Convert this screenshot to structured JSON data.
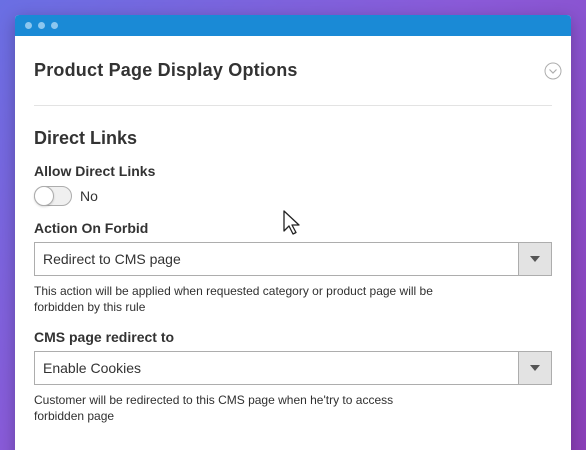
{
  "section": {
    "title": "Product Page Display Options"
  },
  "direct_links": {
    "group_title": "Direct Links",
    "allow_label": "Allow Direct Links",
    "allow_value": "No",
    "action_label": "Action On Forbid",
    "action_value": "Redirect to CMS page",
    "action_note": "This action will be applied when requested category or product page will be forbidden by this rule",
    "cms_label": "CMS page redirect to",
    "cms_value": "Enable Cookies",
    "cms_note": "Customer will be redirected to this CMS page when he'try to access forbidden page"
  },
  "colors": {
    "titlebar": "#1a8ad6",
    "background_start": "#6a6fe3",
    "background_end": "#8b3fb8"
  },
  "icons": {
    "collapse": "chevron-down-circle-icon",
    "select_arrow": "triangle-down-icon",
    "cursor": "mouse-pointer-icon"
  }
}
